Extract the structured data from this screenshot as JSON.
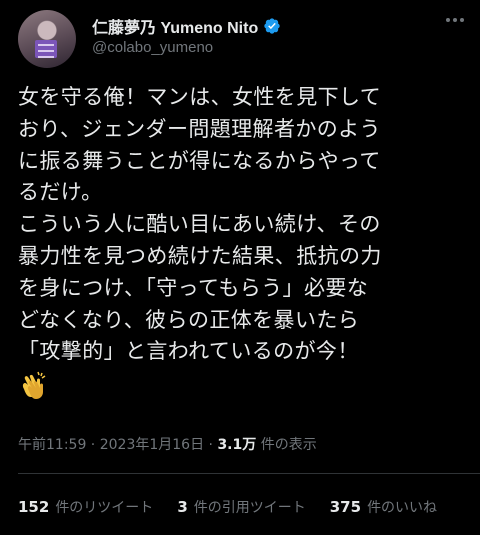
{
  "profile": {
    "display_name": "仁藤夢乃 Yumeno Nito",
    "handle": "@colabo_yumeno",
    "avatar_sign_text": "性売買 合法化 反対",
    "verified_color": "#1d9bf0"
  },
  "tweet": {
    "lines": [
      "女を守る俺！マンは、女性を見下して",
      "おり、ジェンダー問題理解者かのよう",
      "に振る舞うことが得になるからやって",
      "るだけ。",
      "こういう人に酷い目にあい続け、その",
      "暴力性を見つめ続けた結果、抵抗の力",
      "を身につけ、「守ってもらう」必要な",
      "どなくなり、彼らの正体を暴いたら",
      "「攻撃的」と言われているのが今！"
    ],
    "emoji": "clapping-hands"
  },
  "meta": {
    "time": "午前11:59",
    "separator": " · ",
    "date": "2023年1月16日",
    "separator2": " · ",
    "views_count": "3.1万",
    "views_label": " 件の表示"
  },
  "stats": {
    "retweets_count": "152",
    "retweets_label": "件のリツイート",
    "quotes_count": "3",
    "quotes_label": "件の引用ツイート",
    "likes_count": "375",
    "likes_label": "件のいいね"
  }
}
